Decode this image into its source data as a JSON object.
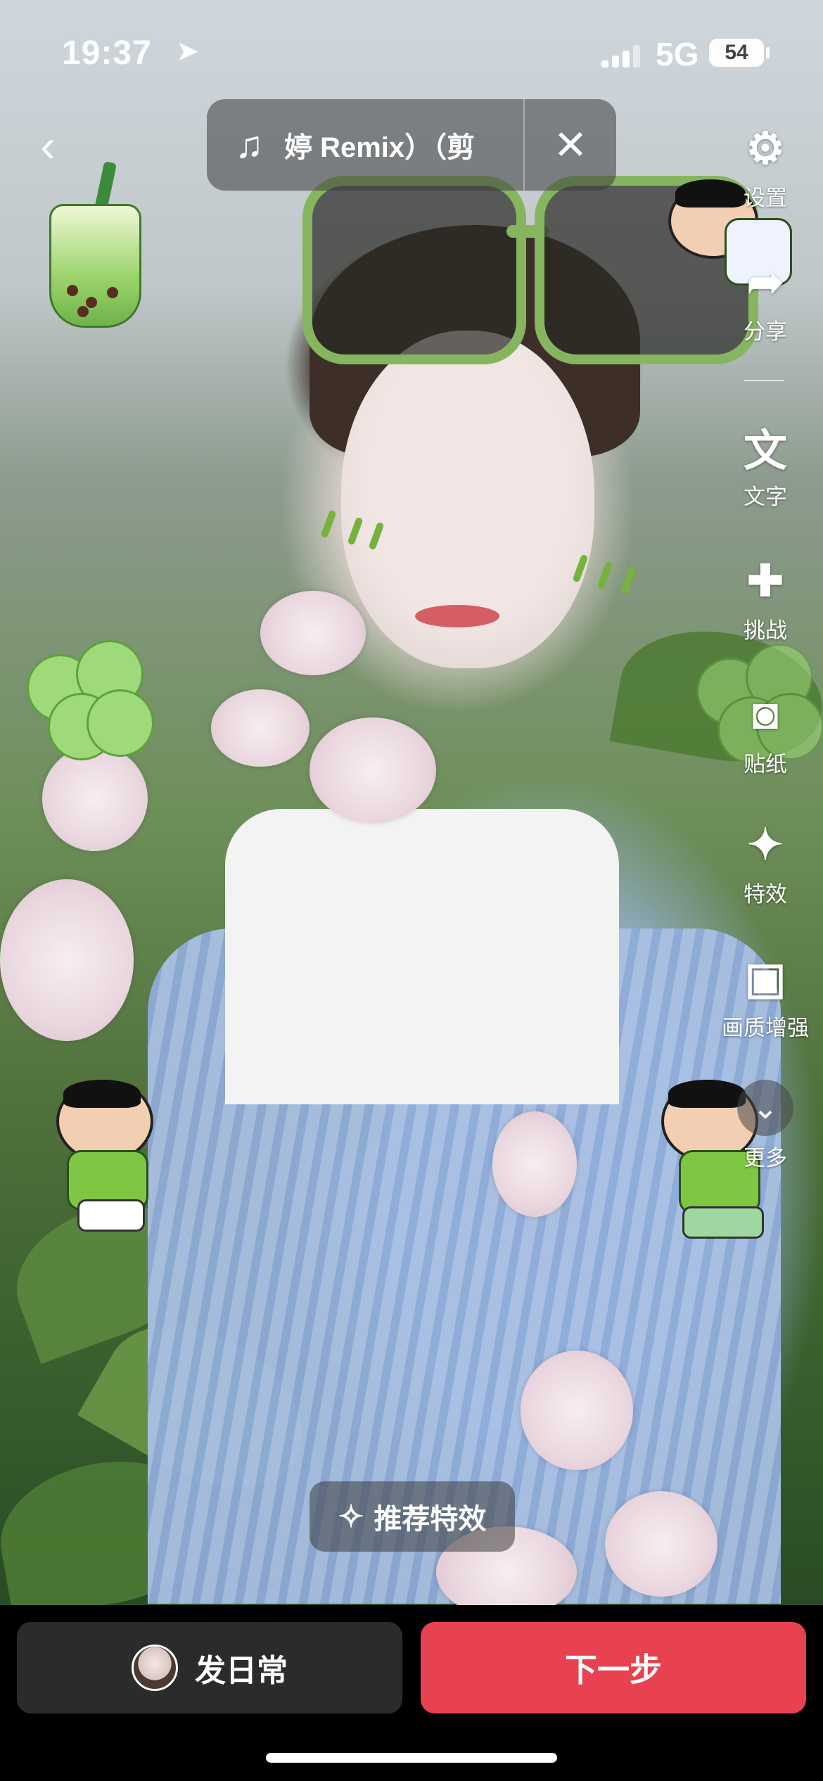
{
  "status_bar": {
    "time": "19:37",
    "network": "5G",
    "battery": "54"
  },
  "music": {
    "title": "婷 Remix）（剪"
  },
  "toolbar": {
    "items": [
      {
        "label": "设置"
      },
      {
        "label": "分享"
      },
      {
        "label": "文字"
      },
      {
        "label": "挑战"
      },
      {
        "label": "贴纸"
      },
      {
        "label": "特效"
      },
      {
        "label": "画质增强"
      },
      {
        "label": "更多"
      }
    ],
    "text_glyph": "文"
  },
  "recommend": {
    "label": "推荐特效"
  },
  "bottom": {
    "daily_label": "发日常",
    "next_label": "下一步"
  },
  "colors": {
    "accent": "#e8414f",
    "dark_button": "#2b2b2b"
  },
  "icons": [
    "back-arrow-icon",
    "music-note-icon",
    "close-icon",
    "gear-icon",
    "share-icon",
    "text-icon",
    "challenge-icon",
    "sticker-icon",
    "sparkle-icon",
    "image-enhance-icon",
    "chevron-down-icon"
  ]
}
